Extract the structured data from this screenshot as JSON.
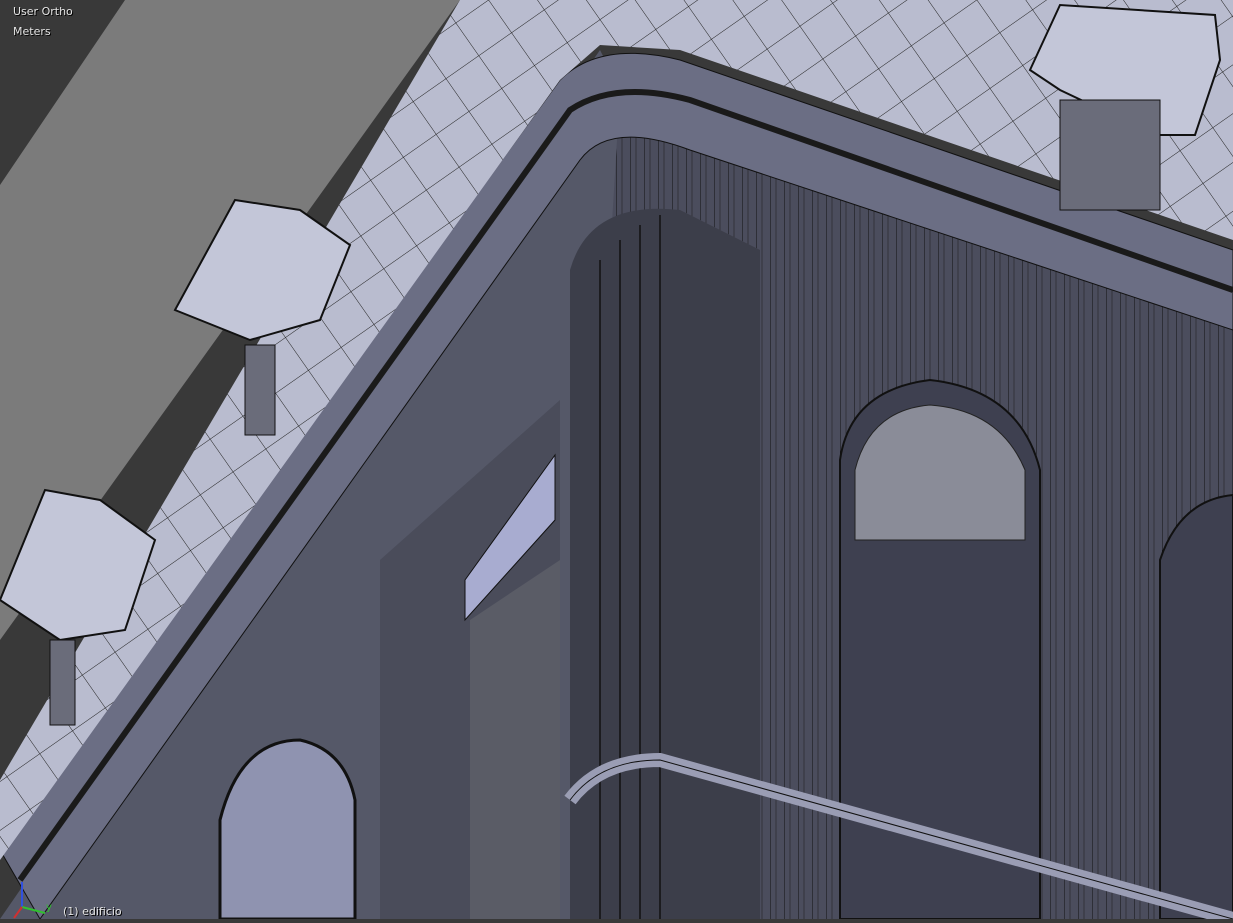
{
  "viewport": {
    "view_name": "User Ortho",
    "units": "Meters",
    "active_object": "(1) edificio",
    "axis_labels": {
      "y": "y"
    }
  },
  "colors": {
    "background": "#393939",
    "ground": "#7b7b7b",
    "roof": "#b9bccf",
    "facade": "#4b4d5d",
    "facade_dark": "#2d2f38",
    "wire": "#000000",
    "axis_x": "#d03030",
    "axis_y": "#30c030",
    "axis_z": "#3050e0"
  }
}
